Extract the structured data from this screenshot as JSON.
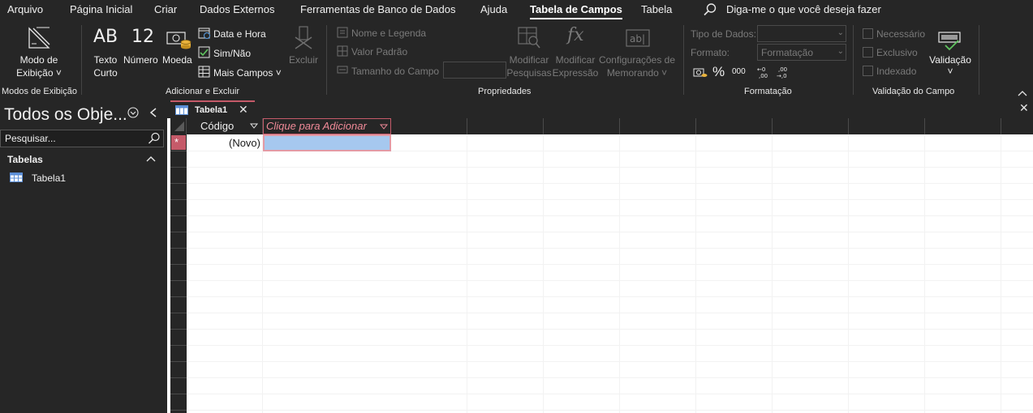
{
  "menu": {
    "tabs": [
      "Arquivo",
      "Página Inicial",
      "Criar",
      "Dados Externos",
      "Ferramentas de Banco de Dados",
      "Ajuda",
      "Tabela de Campos",
      "Tabela"
    ],
    "active_tab": "Tabela de Campos",
    "tell_me": "Diga-me o que você deseja fazer"
  },
  "ribbon": {
    "views": {
      "button_line1": "Modo de",
      "button_line2": "Exibição ˅",
      "group": "Modos de Exibição"
    },
    "add_delete": {
      "texto_line1": "Texto",
      "texto_line2": "Curto",
      "texto_glyph": "AB",
      "numero": "Número",
      "numero_glyph": "12",
      "moeda": "Moeda",
      "data_hora": "Data e Hora",
      "sim_nao": "Sim/Não",
      "mais_campos": "Mais Campos ˅",
      "excluir": "Excluir",
      "group": "Adicionar e Excluir"
    },
    "properties": {
      "nome_legenda": "Nome e Legenda",
      "valor_padrao": "Valor Padrão",
      "tamanho_campo": "Tamanho do Campo",
      "modificar_pesquisas_line1": "Modificar",
      "modificar_pesquisas_line2": "Pesquisas",
      "modificar_expressao_line1": "Modificar",
      "modificar_expressao_line2": "Expressão",
      "config_memorando_line1": "Configurações de",
      "config_memorando_line2": "Memorando ˅",
      "group": "Propriedades"
    },
    "formatting": {
      "tipo_dados": "Tipo de Dados:",
      "formato": "Formato:",
      "formato_value": "Formatação",
      "percent_glyph": "%",
      "thousands_glyph": "000",
      "group": "Formatação"
    },
    "validation": {
      "necessario": "Necessário",
      "exclusivo": "Exclusivo",
      "indexado": "Indexado",
      "validacao_line1": "Validação",
      "validacao_line2": "˅",
      "group": "Validação do Campo"
    }
  },
  "nav": {
    "title": "Todos os Obje...",
    "search_placeholder": "Pesquisar...",
    "section": "Tabelas",
    "items": [
      "Tabela1"
    ]
  },
  "document": {
    "tab_label": "Tabela1",
    "columns": [
      "Código",
      "Clique para Adicionar"
    ],
    "new_row_value": "(Novo)",
    "new_row_marker": "*"
  },
  "colors": {
    "accent": "#c55a69",
    "selected_cell": "#a6c8ef",
    "ribbon_bg": "#262626"
  }
}
